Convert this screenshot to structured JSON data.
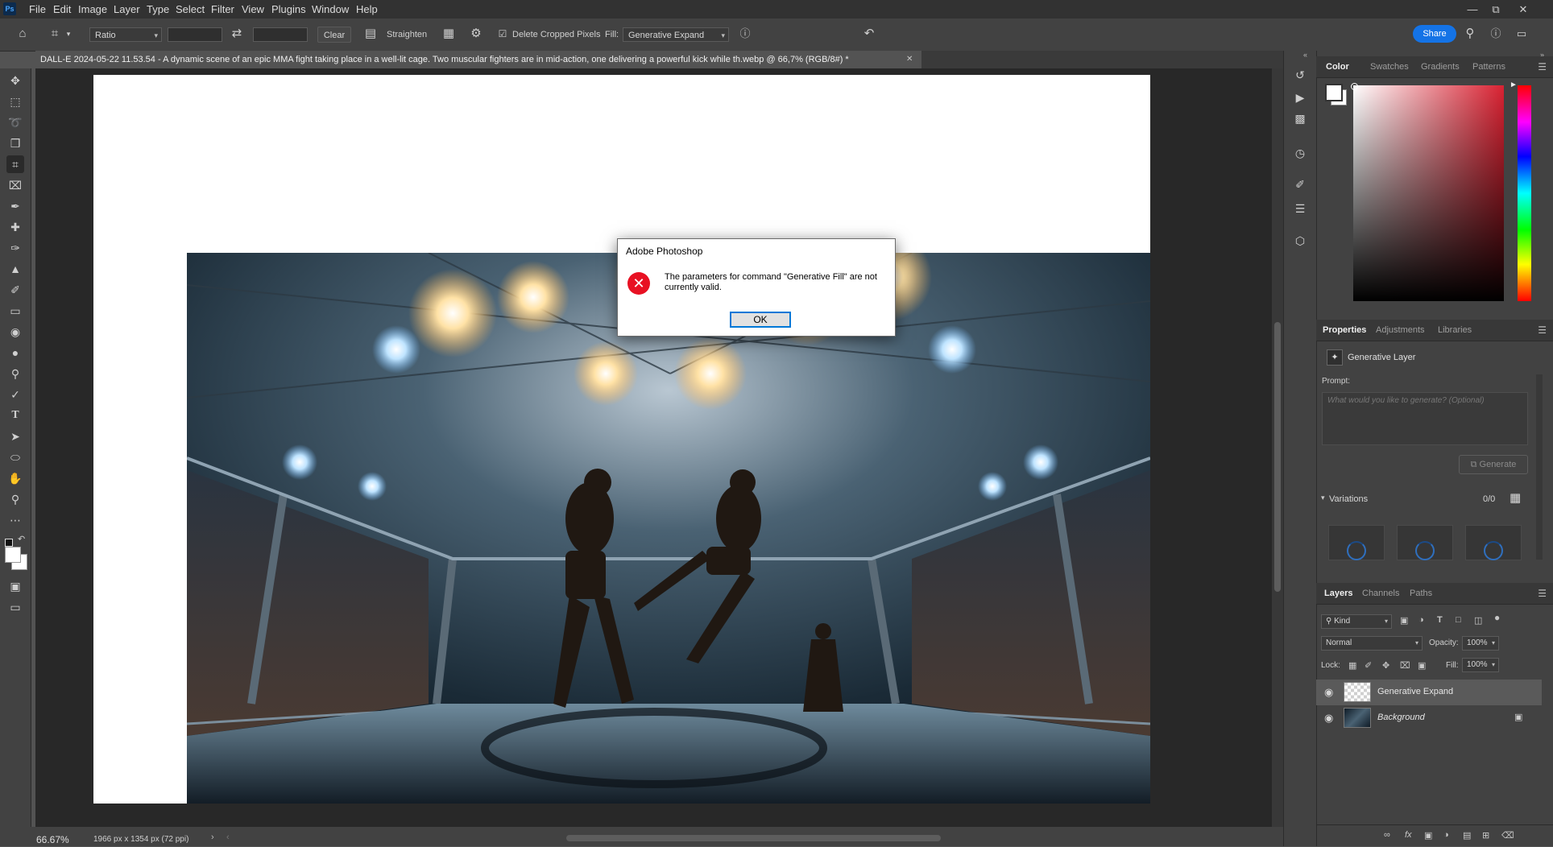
{
  "menubar": {
    "logo": "Ps",
    "items": [
      "File",
      "Edit",
      "Image",
      "Layer",
      "Type",
      "Select",
      "Filter",
      "View",
      "Plugins",
      "Window",
      "Help"
    ],
    "window_controls": [
      "minimize",
      "restore",
      "close"
    ]
  },
  "options": {
    "ratio_label": "Ratio",
    "clear_label": "Clear",
    "straighten_label": "Straighten",
    "delete_cropped_label": "Delete Cropped Pixels",
    "delete_cropped_checked": true,
    "fill_label": "Fill:",
    "fill_value": "Generative Expand",
    "share_label": "Share"
  },
  "document": {
    "tab_title": "DALL-E 2024-05-22 11.53.54 - A dynamic scene of an epic MMA fight taking place in a well-lit cage. Two muscular fighters are in mid-action, one delivering a powerful kick while th.webp @ 66,7% (RGB/8#) *",
    "zoom": "66.67%",
    "size_info": "1966 px x 1354 px (72 ppi)"
  },
  "dialog": {
    "title": "Adobe Photoshop",
    "message": "The parameters for command \"Generative Fill\" are not currently valid.",
    "ok_label": "OK"
  },
  "color_panel": {
    "tabs": [
      "Color",
      "Swatches",
      "Gradients",
      "Patterns"
    ],
    "active_tab": "Color",
    "foreground": "#ffffff",
    "background": "#ffffff",
    "hue_color": "#d92232"
  },
  "properties_panel": {
    "tabs": [
      "Properties",
      "Adjustments",
      "Libraries"
    ],
    "active_tab": "Properties",
    "layer_type": "Generative Layer",
    "prompt_label": "Prompt:",
    "prompt_placeholder": "What would you like to generate? (Optional)",
    "generate_label": "Generate",
    "variations_label": "Variations",
    "variations_count": "0/0"
  },
  "layers_panel": {
    "tabs": [
      "Layers",
      "Channels",
      "Paths"
    ],
    "active_tab": "Layers",
    "filter_kind": "Kind",
    "blend_mode": "Normal",
    "opacity_label": "Opacity:",
    "opacity_value": "100%",
    "lock_label": "Lock:",
    "fill_label": "Fill:",
    "fill_value": "100%",
    "layers": [
      {
        "name": "Generative Expand",
        "visible": true,
        "selected": true
      },
      {
        "name": "Background",
        "visible": true,
        "locked": true
      }
    ]
  },
  "colors": {
    "accent": "#1473e6",
    "error": "#e81123"
  }
}
